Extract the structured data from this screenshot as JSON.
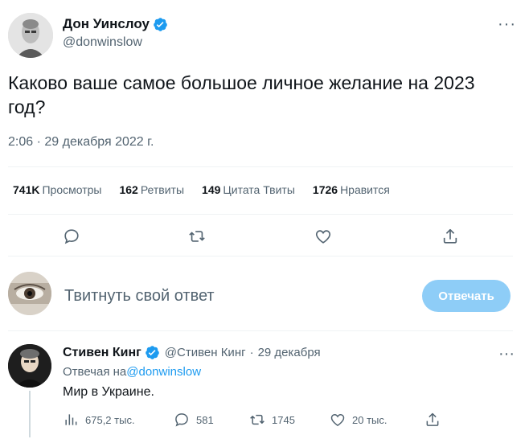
{
  "tweet": {
    "author_name": "Дон Уинслоу",
    "author_handle": "@donwinslow",
    "text": "Каково ваше самое большое личное желание на 2023 год?",
    "timestamp": "2:06 · 29 декабря 2022 г.",
    "more_icon": "more-icon",
    "verified_color": "#1d9bf0"
  },
  "stats": {
    "views_count": "741K",
    "views_label": "Просмотры",
    "retweets_count": "162",
    "retweets_label": "Ретвиты",
    "quotes_count": "149",
    "quotes_label": "Цитата Твиты",
    "likes_count": "1726",
    "likes_label": "Нравится"
  },
  "compose": {
    "placeholder": "Твитнуть свой ответ",
    "button_label": "Отвечать"
  },
  "reply": {
    "author_name": "Стивен Кинг",
    "author_handle": "@Стивен Кинг",
    "separator": "·",
    "date": "29 декабря",
    "replying_to_prefix": "Отвечая на",
    "replying_to_handle": "@donwinslow",
    "text": "Мир в Украине.",
    "views": "675,2 тыс.",
    "replies": "581",
    "retweets": "1745",
    "likes": "20 тыс."
  },
  "colors": {
    "accent": "#1d9bf0",
    "muted": "#536471",
    "button_disabled": "#8ecdf7"
  }
}
